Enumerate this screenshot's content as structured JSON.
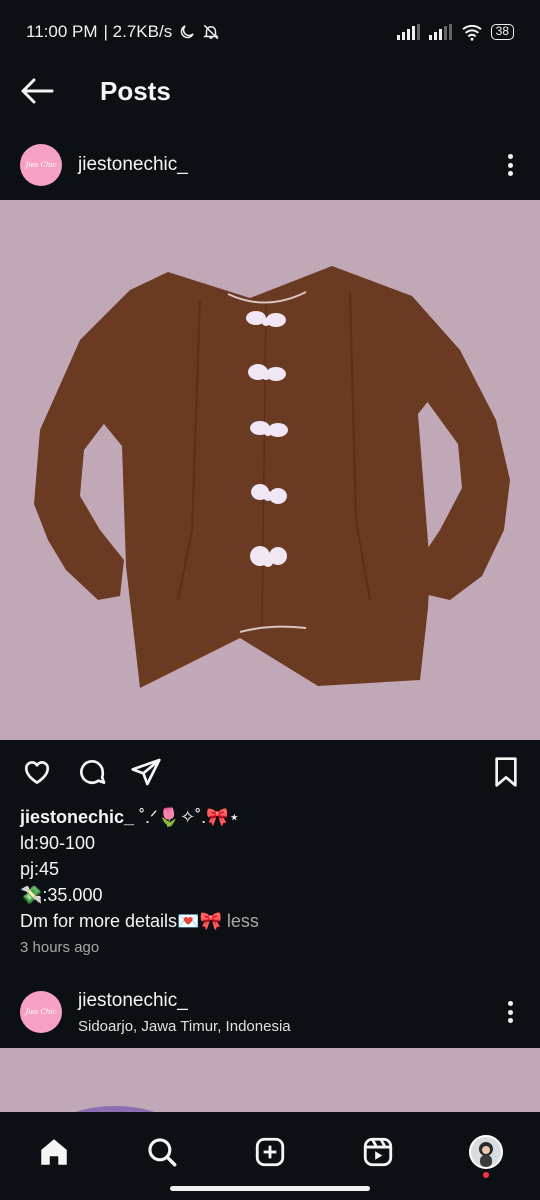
{
  "status_bar": {
    "time": "11:00 PM",
    "speed": "| 2.7KB/s",
    "battery": "38"
  },
  "header": {
    "title": "Posts"
  },
  "post": {
    "avatar_text": "Jies Chic",
    "username": "jiestonechic_",
    "caption_suffix": " ˚.ᐟ🌷✧˚.🎀⋆",
    "caption_lines": [
      "ld:90-100",
      "pj:45",
      "💸:35.000",
      "Dm for more details💌🎀"
    ],
    "less_label": " less",
    "timestamp": "3 hours ago"
  },
  "next_post": {
    "username": "jiestonechic_",
    "location": "Sidoarjo, Jawa Timur, Indonesia"
  },
  "colors": {
    "background": "#0c1014",
    "image_backdrop": "#c1a8b7",
    "shirt": "#6b3a22",
    "avatar": "#f6a0c4"
  },
  "icons": {
    "back": "arrow-left-icon",
    "more": "more-vertical-icon",
    "like": "heart-icon",
    "comment": "comment-icon",
    "share": "send-icon",
    "save": "bookmark-icon",
    "nav": [
      "home-icon",
      "search-icon",
      "create-icon",
      "reels-icon",
      "profile-icon"
    ]
  }
}
